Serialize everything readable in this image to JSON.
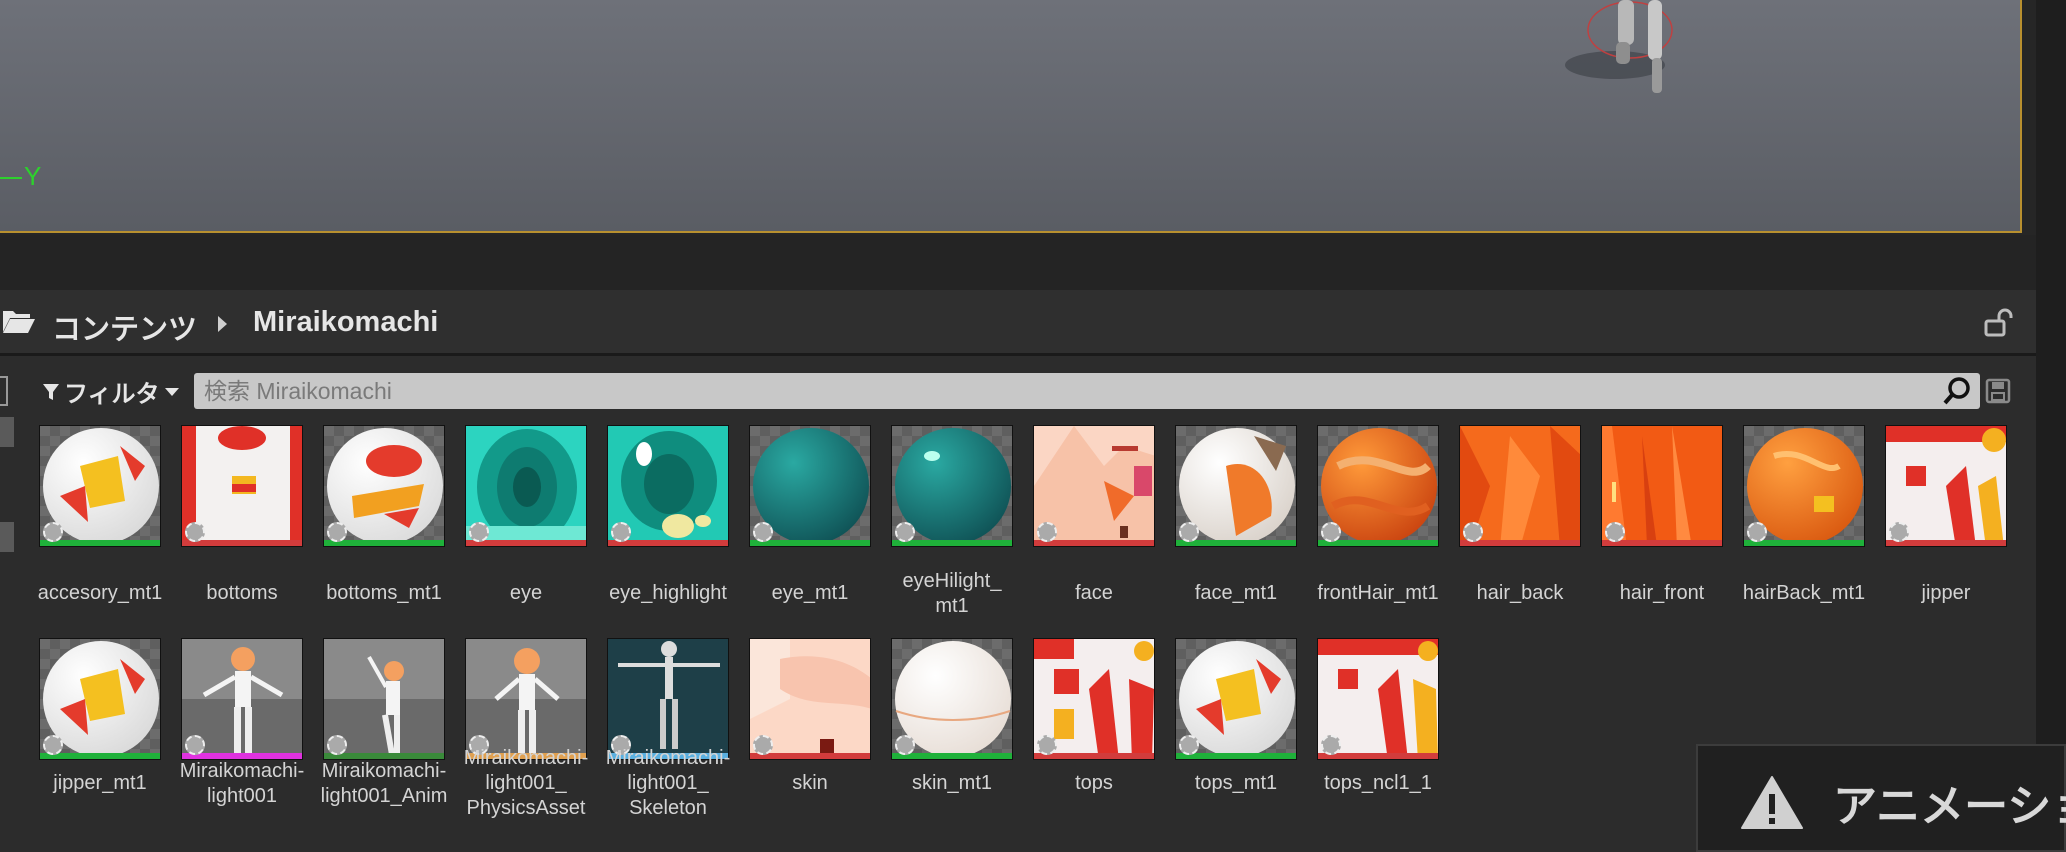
{
  "viewport": {
    "axis_label": "Y"
  },
  "breadcrumb": {
    "root": "コンテンツ",
    "current": "Miraikomachi"
  },
  "toolbar": {
    "filter_label": "フィルタ",
    "search_placeholder": "検索 Miraikomachi"
  },
  "assets": [
    {
      "name": "accesory_mt1",
      "kind": "material",
      "bar": "#1fb13a"
    },
    {
      "name": "bottoms",
      "kind": "texture",
      "bar": "#d23c3c"
    },
    {
      "name": "bottoms_mt1",
      "kind": "material",
      "bar": "#1fb13a"
    },
    {
      "name": "eye",
      "kind": "texture",
      "bar": "#d23c3c"
    },
    {
      "name": "eye_highlight",
      "kind": "texture",
      "bar": "#d23c3c"
    },
    {
      "name": "eye_mt1",
      "kind": "material",
      "bar": "#1fb13a"
    },
    {
      "name": "eyeHilight_mt1",
      "kind": "material",
      "bar": "#1fb13a"
    },
    {
      "name": "face",
      "kind": "texture",
      "bar": "#d23c3c"
    },
    {
      "name": "face_mt1",
      "kind": "material",
      "bar": "#1fb13a"
    },
    {
      "name": "frontHair_mt1",
      "kind": "material",
      "bar": "#1fb13a"
    },
    {
      "name": "hair_back",
      "kind": "texture",
      "bar": "#d23c3c"
    },
    {
      "name": "hair_front",
      "kind": "texture",
      "bar": "#d23c3c"
    },
    {
      "name": "hairBack_mt1",
      "kind": "material",
      "bar": "#1fb13a"
    },
    {
      "name": "jipper",
      "kind": "texture",
      "bar": "#d23c3c"
    },
    {
      "name": "jipper_mt1",
      "kind": "material",
      "bar": "#1fb13a"
    },
    {
      "name": "Miraikomachi-light001",
      "kind": "mesh",
      "bar": "#e032e0"
    },
    {
      "name": "Miraikomachi-light001_Anim",
      "kind": "anim",
      "bar": "#3a8a3a"
    },
    {
      "name": "Miraikomachi-light001_PhysicsAsset",
      "kind": "physics",
      "bar": "#e0a050"
    },
    {
      "name": "Miraikomachi-light001_Skeleton",
      "kind": "skeleton",
      "bar": "#5ab0e0"
    },
    {
      "name": "skin",
      "kind": "texture",
      "bar": "#d23c3c"
    },
    {
      "name": "skin_mt1",
      "kind": "material",
      "bar": "#1fb13a"
    },
    {
      "name": "tops",
      "kind": "texture",
      "bar": "#d23c3c"
    },
    {
      "name": "tops_mt1",
      "kind": "material",
      "bar": "#1fb13a"
    },
    {
      "name": "tops_ncl1_1",
      "kind": "texture",
      "bar": "#d23c3c"
    }
  ],
  "asset_labels": [
    [
      "accesory_mt1"
    ],
    [
      "bottoms"
    ],
    [
      "bottoms_mt1"
    ],
    [
      "eye"
    ],
    [
      "eye_highlight"
    ],
    [
      "eye_mt1"
    ],
    [
      "eyeHilight_",
      "mt1"
    ],
    [
      "face"
    ],
    [
      "face_mt1"
    ],
    [
      "frontHair_mt1"
    ],
    [
      "hair_back"
    ],
    [
      "hair_front"
    ],
    [
      "hairBack_mt1"
    ],
    [
      "jipper"
    ],
    [
      "jipper_mt1"
    ],
    [
      "Miraikomachi-",
      "light001"
    ],
    [
      "Miraikomachi-",
      "light001_Anim"
    ],
    [
      "Miraikomachi-",
      "light001_",
      "PhysicsAsset"
    ],
    [
      "Miraikomachi-",
      "light001_",
      "Skeleton"
    ],
    [
      "skin"
    ],
    [
      "skin_mt1"
    ],
    [
      "tops"
    ],
    [
      "tops_mt1"
    ],
    [
      "tops_ncl1_1"
    ]
  ],
  "notification": {
    "text": "アニメーショ"
  }
}
